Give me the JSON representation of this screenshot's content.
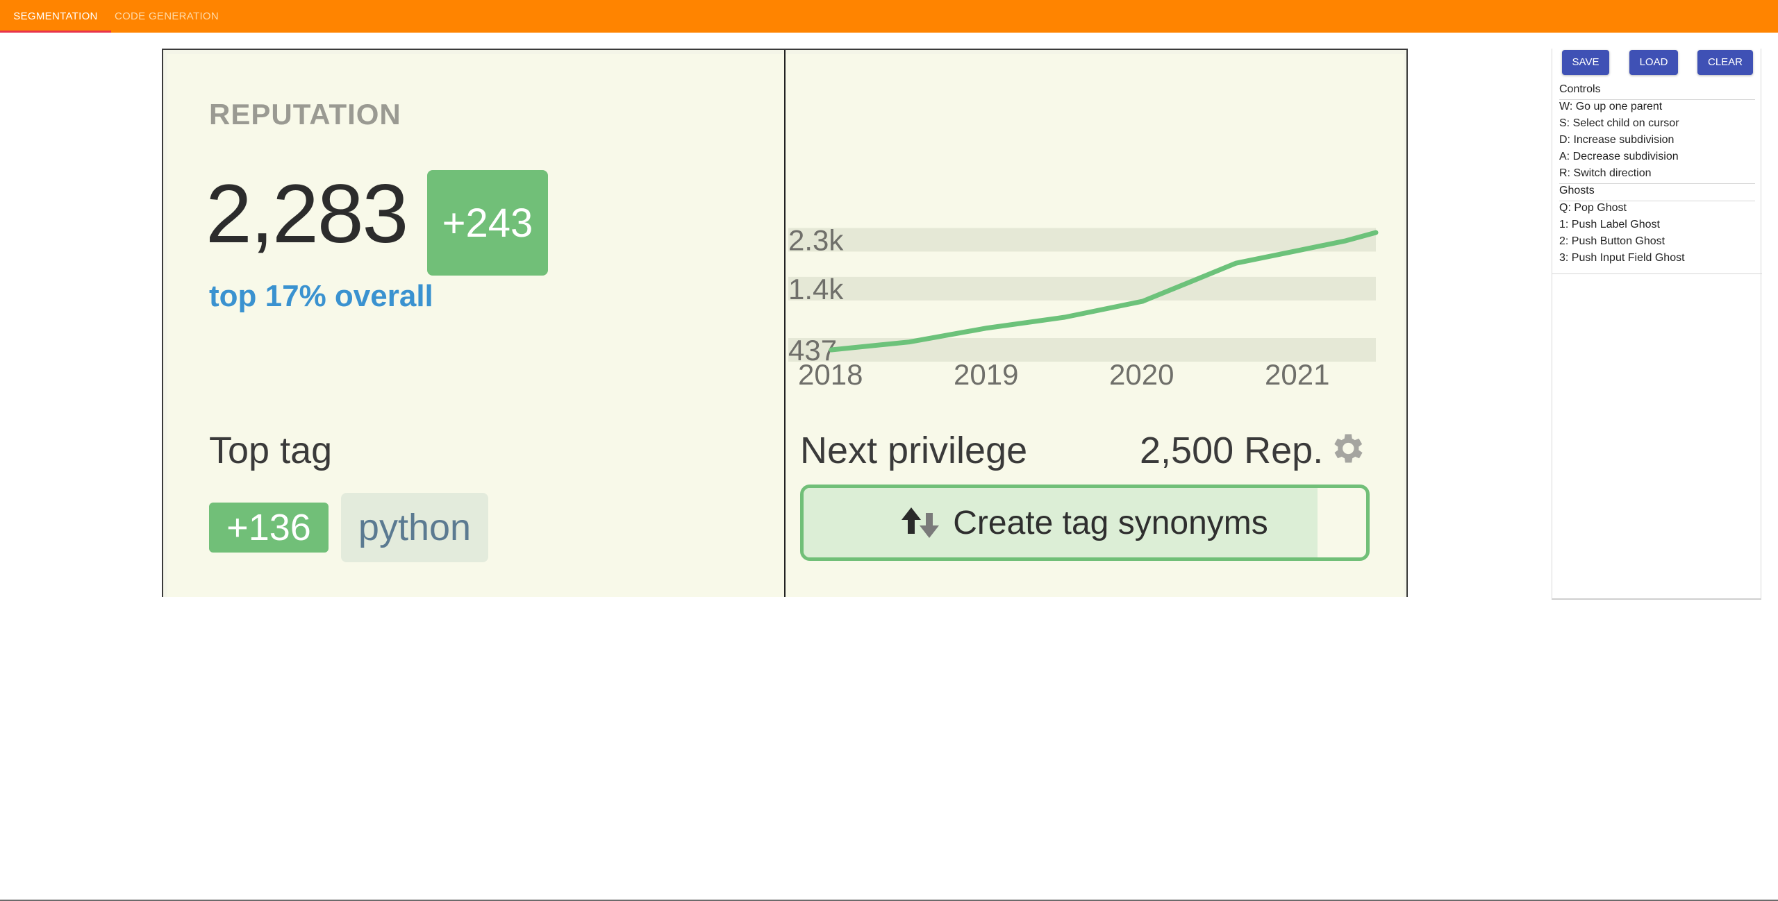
{
  "app": {
    "tabs": [
      {
        "label": "SEGMENTATION",
        "active": true
      },
      {
        "label": "CODE GENERATION",
        "active": false
      }
    ],
    "colors": {
      "appbar": "#ff8400",
      "tab_indicator": "#e8344d",
      "button": "#3f51b5"
    }
  },
  "card": {
    "reputation": {
      "heading": "REPUTATION",
      "value": "2,283",
      "delta": "+243",
      "rank": "top 17% overall"
    },
    "top_tag": {
      "heading": "Top tag",
      "score": "+136",
      "name": "python"
    },
    "next_privilege": {
      "heading": "Next privilege",
      "rep_required": "2,500 Rep.",
      "privilege_label": "Create tag synonyms",
      "progress_fraction": 0.913,
      "icon": "gear-icon"
    },
    "chart_data": {
      "type": "line",
      "y_ticks": [
        "2.3k",
        "1.4k",
        "437"
      ],
      "y_tick_values": [
        2300,
        1400,
        437
      ],
      "x_ticks": [
        "2018",
        "2019",
        "2020",
        "2021"
      ],
      "x_tick_values": [
        2018,
        2019,
        2020,
        2021
      ],
      "series": [
        {
          "x": [
            2018.0,
            2018.5,
            2019.0,
            2019.5,
            2020.0,
            2020.3,
            2020.6,
            2021.0,
            2021.3,
            2021.5
          ],
          "y": [
            437,
            560,
            780,
            950,
            1200,
            1500,
            1800,
            2000,
            2150,
            2283
          ]
        }
      ],
      "ylim": [
        437,
        2283
      ],
      "xlim": [
        2018,
        2021.5
      ],
      "grid": "horizontal bands",
      "line_color": "#6cc27a"
    }
  },
  "panel": {
    "buttons": {
      "save": "SAVE",
      "load": "LOAD",
      "clear": "CLEAR"
    },
    "controls_title": "Controls",
    "controls": [
      "W: Go up one parent",
      "S: Select child on cursor",
      "D: Increase subdivision",
      "A: Decrease subdivision",
      "R: Switch direction"
    ],
    "ghosts_title": "Ghosts",
    "ghosts": [
      "Q: Pop Ghost",
      "1: Push Label Ghost",
      "2: Push Button Ghost",
      "3: Push Input Field Ghost"
    ]
  }
}
